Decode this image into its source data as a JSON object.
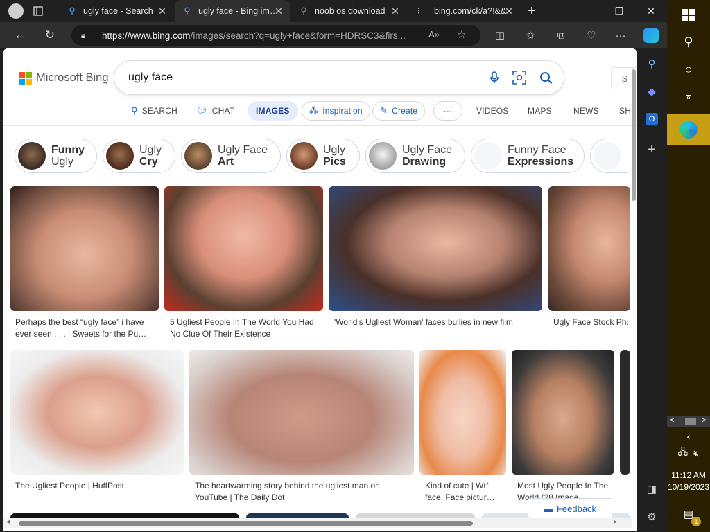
{
  "browser": {
    "tabs": [
      {
        "title": "",
        "icon": "profile-avatar-icon"
      },
      {
        "title": "ugly face - Search",
        "icon": "search-icon"
      },
      {
        "title": "ugly face - Bing im…",
        "icon": "search-icon"
      },
      {
        "title": "noob os download",
        "icon": "search-icon"
      },
      {
        "title": "bing.com/ck/a?!&&",
        "icon": "page-icon"
      }
    ],
    "url_host": "https://www.bing.com",
    "url_path": "/images/search?q=ugly+face&form=HDRSC3&firs..."
  },
  "bing": {
    "brand": "Microsoft Bing",
    "query": "ugly face",
    "signin": "S",
    "nav": {
      "search": "SEARCH",
      "chat": "CHAT",
      "images": "IMAGES",
      "inspiration": "Inspiration",
      "create": "Create",
      "more": "···",
      "videos": "VIDEOS",
      "maps": "MAPS",
      "news": "NEWS",
      "shopping": "SH"
    },
    "chips": [
      {
        "l1": "Funny",
        "l2": "Ugly"
      },
      {
        "l1": "Ugly",
        "l2": "Cry"
      },
      {
        "l1": "Ugly Face",
        "l2": "Art"
      },
      {
        "l1": "Ugly",
        "l2": "Pics"
      },
      {
        "l1": "Ugly Face",
        "l2": "Drawing"
      },
      {
        "l1": "Funny Face",
        "l2": "Expressions"
      }
    ],
    "results": [
      {
        "caption": "Perhaps the best “ugly face” i have ever seen . . . | Sweets for the Pu…"
      },
      {
        "caption": "5 Ugliest People In The World You Had No Clue Of Their Existence"
      },
      {
        "caption": "'World's Ugliest Woman' faces bullies in new film"
      },
      {
        "caption": "Ugly Face Stock Pho… Royalty-Free Images"
      },
      {
        "caption": "The Ugliest People | HuffPost"
      },
      {
        "caption": "The heartwarming story behind the ugliest man on YouTube | The Daily Dot"
      },
      {
        "caption": "Kind of cute | Wtf face, Face pictur…"
      },
      {
        "caption": "Most Ugly People In The World (28 Image…"
      }
    ],
    "feedback": "Feedback"
  },
  "taskbar": {
    "time": "11:12 AM",
    "date": "10/19/2023",
    "notification_count": "1"
  },
  "colors": {
    "accent": "#1a5db6",
    "taskbar_active": "#c79f15"
  }
}
